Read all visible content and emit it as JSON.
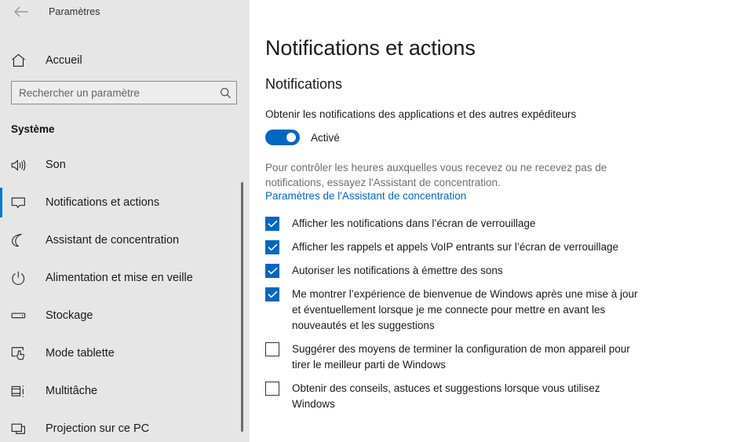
{
  "window": {
    "app_title": "Paramètres",
    "back_icon": "back-arrow-icon"
  },
  "sidebar": {
    "home": {
      "label": "Accueil",
      "icon": "home-icon"
    },
    "search": {
      "placeholder": "Rechercher un paramètre",
      "value": "",
      "icon": "search-icon"
    },
    "group_header": "Système",
    "items": [
      {
        "label": "Son",
        "icon": "speaker-icon",
        "selected": false
      },
      {
        "label": "Notifications et actions",
        "icon": "speech-bubble-icon",
        "selected": true
      },
      {
        "label": "Assistant de concentration",
        "icon": "moon-icon",
        "selected": false
      },
      {
        "label": "Alimentation et mise en veille",
        "icon": "power-icon",
        "selected": false
      },
      {
        "label": "Stockage",
        "icon": "drive-icon",
        "selected": false
      },
      {
        "label": "Mode tablette",
        "icon": "tablet-hand-icon",
        "selected": false
      },
      {
        "label": "Multitâche",
        "icon": "multitask-icon",
        "selected": false
      },
      {
        "label": "Projection sur ce PC",
        "icon": "projection-icon",
        "selected": false
      }
    ]
  },
  "main": {
    "page_title": "Notifications et actions",
    "section_title": "Notifications",
    "master_setting": {
      "description": "Obtenir les notifications des applications et des autres expéditeurs",
      "toggle_state_label": "Activé",
      "toggle_on": true
    },
    "hint_text": "Pour contrôler les heures auxquelles vous recevez ou ne recevez pas de notifications, essayez l'Assistant de concentration.",
    "hint_link": "Paramètres de l'Assistant de concentration",
    "checkboxes": [
      {
        "label": "Afficher les notifications dans l’écran de verrouillage",
        "checked": true
      },
      {
        "label": "Afficher les rappels et appels VoIP entrants sur l’écran de verrouillage",
        "checked": true
      },
      {
        "label": "Autoriser les notifications à émettre des sons",
        "checked": true
      },
      {
        "label": "Me montrer l’expérience de bienvenue de Windows après une mise à jour et éventuellement lorsque je me connecte pour mettre en avant les nouveautés et les suggestions",
        "checked": true
      },
      {
        "label": "Suggérer des moyens de terminer la configuration de mon appareil pour tirer le meilleur parti de Windows",
        "checked": false
      },
      {
        "label": "Obtenir des conseils, astuces et suggestions lorsque vous utilisez Windows",
        "checked": false
      }
    ]
  },
  "colors": {
    "accent": "#0067c0",
    "selection_bar": "#0078d4",
    "link": "#0066cc",
    "sidebar_bg": "#e6e6e6"
  }
}
